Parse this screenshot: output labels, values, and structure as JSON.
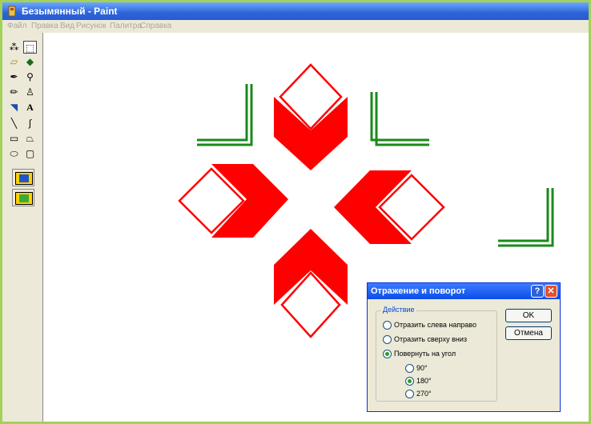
{
  "window": {
    "title": "Безымянный - Paint"
  },
  "menu": [
    "Файл",
    "Правка",
    "Вид",
    "Рисунок",
    "Палитра",
    "Справка"
  ],
  "tools": [
    {
      "name": "free-select-icon",
      "glyph": "⁂"
    },
    {
      "name": "rect-select-icon",
      "glyph": "⬚"
    },
    {
      "name": "eraser-icon",
      "glyph": "▱"
    },
    {
      "name": "fill-icon",
      "glyph": "◆"
    },
    {
      "name": "color-picker-icon",
      "glyph": "✒"
    },
    {
      "name": "magnifier-icon",
      "glyph": "⚲"
    },
    {
      "name": "pencil-icon",
      "glyph": "✏"
    },
    {
      "name": "brush-icon",
      "glyph": "♙"
    },
    {
      "name": "airbrush-icon",
      "glyph": "◥"
    },
    {
      "name": "text-icon",
      "glyph": "A"
    },
    {
      "name": "line-icon",
      "glyph": "╲"
    },
    {
      "name": "curve-icon",
      "glyph": "∫"
    },
    {
      "name": "rectangle-icon",
      "glyph": "▭"
    },
    {
      "name": "polygon-icon",
      "glyph": "⏢"
    },
    {
      "name": "ellipse-icon",
      "glyph": "⬭"
    },
    {
      "name": "rounded-rect-icon",
      "glyph": "▢"
    }
  ],
  "dialog": {
    "title": "Отражение и поворот",
    "help": "?",
    "close": "✕",
    "group_label": "Действие",
    "options": [
      "Отразить слева направо",
      "Отразить сверху вниз",
      "Повернуть на угол"
    ],
    "angles": [
      "90°",
      "180°",
      "270°"
    ],
    "ok": "OK",
    "cancel": "Отмена"
  },
  "colors": {
    "ornament_red": "#ff0000",
    "corner_green": "#1a8a1a"
  }
}
